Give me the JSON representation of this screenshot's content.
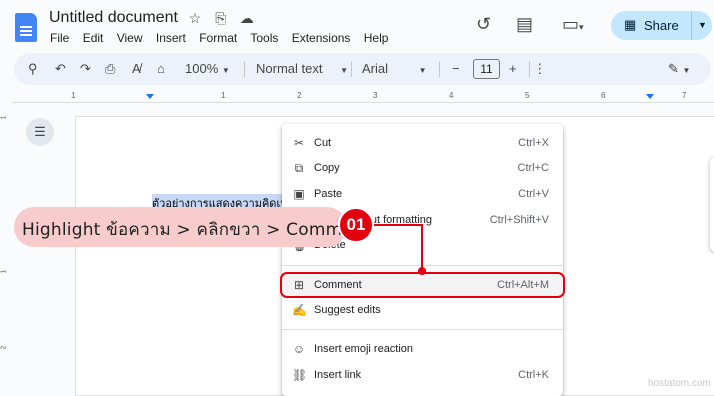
{
  "header": {
    "title": "Untitled document",
    "menu": [
      "File",
      "Edit",
      "View",
      "Insert",
      "Format",
      "Tools",
      "Extensions",
      "Help"
    ],
    "title_icons": [
      "star-icon",
      "move-folder-icon",
      "cloud-icon"
    ],
    "right_icons": [
      "history-icon",
      "comments-icon",
      "video-call-icon"
    ],
    "share_label": "Share"
  },
  "toolbar": {
    "zoom": "100%",
    "style": "Normal text",
    "font": "Arial",
    "font_size": "11",
    "minus": "−",
    "plus": "+"
  },
  "ruler": {
    "numbers": [
      "1",
      "1",
      "2",
      "3",
      "4",
      "5",
      "6",
      "7"
    ],
    "vertical_numbers": [
      "1",
      "1",
      "2"
    ]
  },
  "document": {
    "selected_text": "ตัวอย่างการแสดงความคิดเห็"
  },
  "context_menu": {
    "items": [
      {
        "icon": "scissors-icon",
        "label": "Cut",
        "shortcut": "Ctrl+X"
      },
      {
        "icon": "copy-icon",
        "label": "Copy",
        "shortcut": "Ctrl+C"
      },
      {
        "icon": "paste-icon",
        "label": "Paste",
        "shortcut": "Ctrl+V"
      },
      {
        "icon": "paste-plain-icon",
        "label": "Paste without formatting",
        "shortcut": "Ctrl+Shift+V"
      },
      {
        "icon": "trash-icon",
        "label": "Delete",
        "shortcut": ""
      },
      {
        "icon": "add-comment-icon",
        "label": "Comment",
        "shortcut": "Ctrl+Alt+M"
      },
      {
        "icon": "suggest-edits-icon",
        "label": "Suggest edits",
        "shortcut": ""
      },
      {
        "icon": "emoji-icon",
        "label": "Insert emoji reaction",
        "shortcut": ""
      },
      {
        "icon": "link-icon",
        "label": "Insert link",
        "shortcut": "Ctrl+K"
      }
    ]
  },
  "annotation": {
    "callout": "Highlight ข้อความ > คลิกขวา > Comment",
    "step": "01",
    "color": "#e3000f"
  },
  "watermark": "hostatom.com"
}
